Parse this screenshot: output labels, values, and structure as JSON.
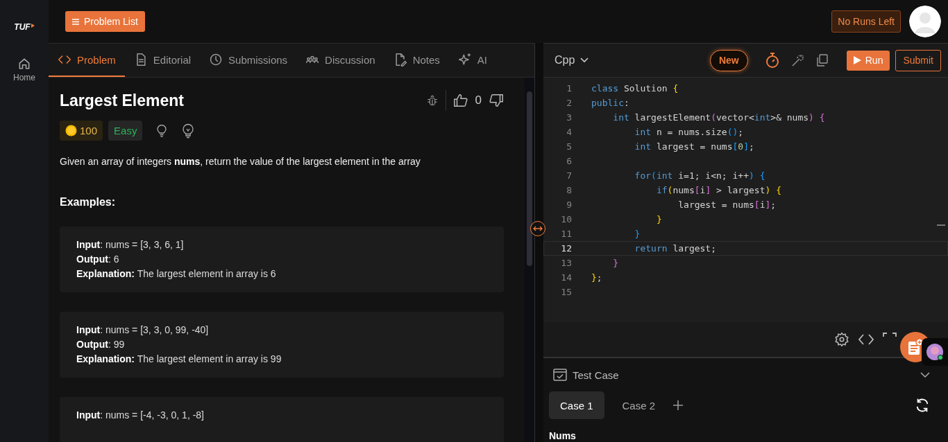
{
  "rail": {
    "logo": "TUF",
    "items": [
      {
        "label": "Home",
        "selected": false
      }
    ]
  },
  "topbar": {
    "problem_list": "Problem List",
    "runs": "No Runs Left"
  },
  "tabs": [
    {
      "label": "Problem",
      "selected": true
    },
    {
      "label": "Editorial",
      "selected": false
    },
    {
      "label": "Submissions",
      "selected": false
    },
    {
      "label": "Discussion",
      "selected": false
    },
    {
      "label": "Notes",
      "selected": false
    },
    {
      "label": "AI",
      "selected": false
    }
  ],
  "problem": {
    "title": "Largest Element",
    "likes": "0",
    "coins": "100",
    "difficulty": "Easy",
    "description": "Given an array of integers **nums**, return the value of the largest element in the array",
    "examples_heading": "Examples:",
    "examples": [
      [
        "**Input**: nums = [3, 3, 6, 1]",
        "**Output**: 6",
        "**Explanation:** The largest element in array is 6"
      ],
      [
        "**Input**: nums = [3, 3, 0, 99, -40]",
        "**Output**: 99",
        "**Explanation:** The largest element in array is 99"
      ],
      [
        "**Input**: nums = [-4, -3, 0, 1, -8]"
      ]
    ]
  },
  "editor": {
    "language": "Cpp",
    "new": "New",
    "run": "Run",
    "submit": "Submit",
    "lines": [
      {
        "number": "1",
        "current": false,
        "tokens": [
          {
            "text": "class",
            "kind": "kw"
          },
          {
            "text": " Solution",
            "kind": "plain"
          },
          {
            "text": " {",
            "kind": "b1"
          }
        ]
      },
      {
        "number": "2",
        "current": false,
        "tokens": [
          {
            "text": "public",
            "kind": "kw"
          },
          {
            "text": ":",
            "kind": "plain"
          }
        ]
      },
      {
        "number": "3",
        "current": false,
        "tokens": [
          {
            "text": "    int",
            "kind": "kw"
          },
          {
            "text": " largestElement",
            "kind": "plain"
          },
          {
            "text": "(",
            "kind": "b2"
          },
          {
            "text": "vector<",
            "kind": "plain"
          },
          {
            "text": "int",
            "kind": "kw"
          },
          {
            "text": ">& nums",
            "kind": "plain"
          },
          {
            "text": ")",
            "kind": "b2"
          },
          {
            "text": " {",
            "kind": "b2"
          }
        ]
      },
      {
        "number": "4",
        "current": false,
        "tokens": [
          {
            "text": "        int",
            "kind": "kw"
          },
          {
            "text": " n = nums.size",
            "kind": "plain"
          },
          {
            "text": "()",
            "kind": "b3"
          },
          {
            "text": ";",
            "kind": "plain"
          }
        ]
      },
      {
        "number": "5",
        "current": false,
        "tokens": [
          {
            "text": "        int",
            "kind": "kw"
          },
          {
            "text": " largest = nums",
            "kind": "plain"
          },
          {
            "text": "[",
            "kind": "b3"
          },
          {
            "text": "0",
            "kind": "num"
          },
          {
            "text": "]",
            "kind": "b3"
          },
          {
            "text": ";",
            "kind": "plain"
          }
        ]
      },
      {
        "number": "6",
        "current": false
      },
      {
        "number": "7",
        "current": false,
        "tokens": [
          {
            "text": "        for",
            "kind": "kw"
          },
          {
            "text": "(",
            "kind": "b3"
          },
          {
            "text": "int",
            "kind": "kw"
          },
          {
            "text": " i=1; i<n; i++",
            "kind": "plain"
          },
          {
            "text": ")",
            "kind": "b3"
          },
          {
            "text": " {",
            "kind": "b3"
          }
        ]
      },
      {
        "number": "8",
        "current": false,
        "tokens": [
          {
            "text": "            if",
            "kind": "kw"
          },
          {
            "text": "(",
            "kind": "b1"
          },
          {
            "text": "nums",
            "kind": "plain"
          },
          {
            "text": "[",
            "kind": "b2"
          },
          {
            "text": "i",
            "kind": "plain"
          },
          {
            "text": "]",
            "kind": "b2"
          },
          {
            "text": " > largest",
            "kind": "plain"
          },
          {
            "text": ")",
            "kind": "b1"
          },
          {
            "text": " {",
            "kind": "b1"
          }
        ]
      },
      {
        "number": "9",
        "current": false,
        "tokens": [
          {
            "text": "                largest = nums",
            "kind": "plain"
          },
          {
            "text": "[",
            "kind": "b2"
          },
          {
            "text": "i",
            "kind": "plain"
          },
          {
            "text": "]",
            "kind": "b2"
          },
          {
            "text": ";",
            "kind": "plain"
          }
        ]
      },
      {
        "number": "10",
        "current": false,
        "tokens": [
          {
            "text": "            }",
            "kind": "b1"
          }
        ]
      },
      {
        "number": "11",
        "current": false,
        "tokens": [
          {
            "text": "        }",
            "kind": "b3"
          }
        ]
      },
      {
        "number": "12",
        "current": true,
        "tokens": [
          {
            "text": "        return",
            "kind": "kw"
          },
          {
            "text": " largest;",
            "kind": "plain"
          }
        ]
      },
      {
        "number": "13",
        "current": false,
        "tokens": [
          {
            "text": "    }",
            "kind": "b2"
          }
        ]
      },
      {
        "number": "14",
        "current": false,
        "tokens": [
          {
            "text": "}",
            "kind": "b1"
          },
          {
            "text": ";",
            "kind": "plain"
          }
        ]
      },
      {
        "number": "15",
        "current": false
      }
    ]
  },
  "testcase": {
    "title": "Test Case",
    "cases": [
      {
        "label": "Case 1",
        "selected": true
      },
      {
        "label": "Case 2",
        "selected": false
      }
    ],
    "field_label": "Nums"
  }
}
